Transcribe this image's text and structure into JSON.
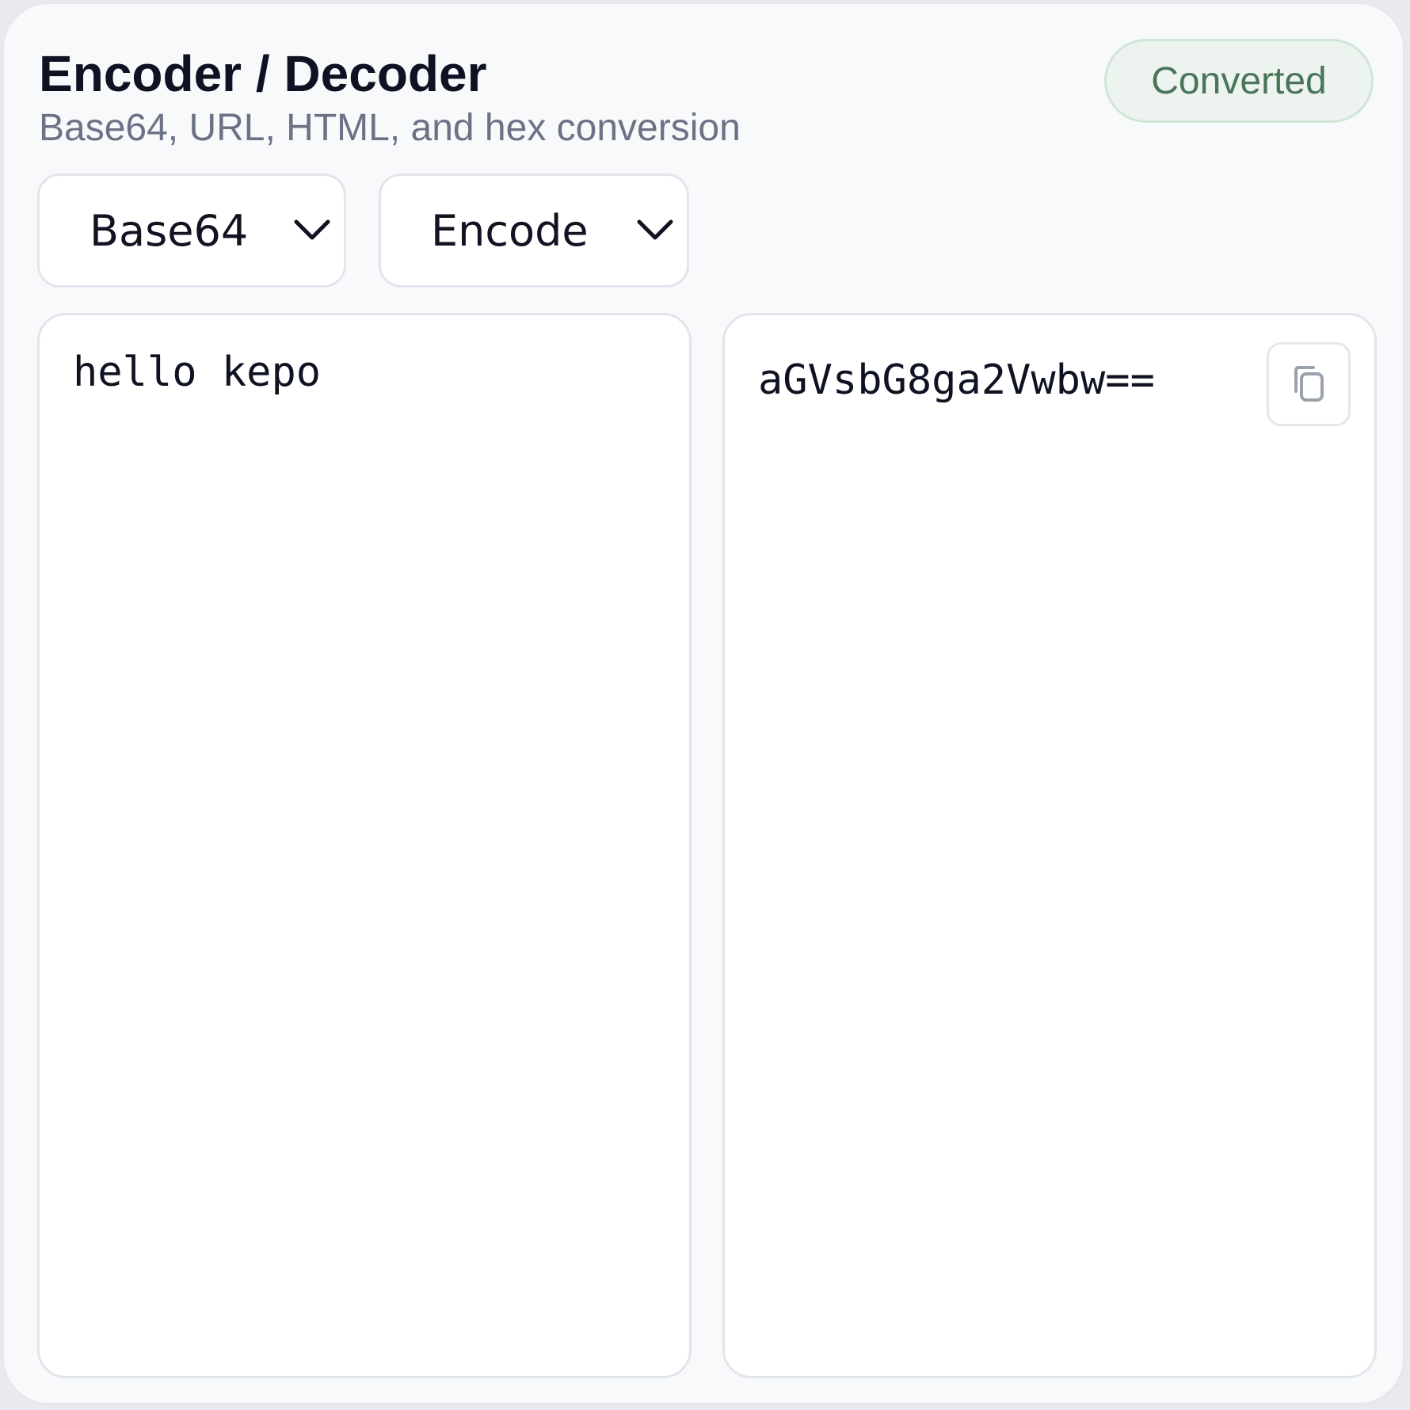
{
  "header": {
    "title": "Encoder / Decoder",
    "subtitle": "Base64, URL, HTML, and hex conversion",
    "status_badge": "Converted"
  },
  "controls": {
    "format_select": {
      "value": "Base64"
    },
    "mode_select": {
      "value": "Encode"
    }
  },
  "input": {
    "value": "hello kepo"
  },
  "output": {
    "value": "aGVsbG8ga2Vwbw=="
  },
  "icons": {
    "chevron": "chevron-down-icon",
    "copy": "copy-icon"
  },
  "colors": {
    "badge_bg": "#edf3ef",
    "badge_text": "#4a7558",
    "card_bg": "#f8f9fb"
  }
}
